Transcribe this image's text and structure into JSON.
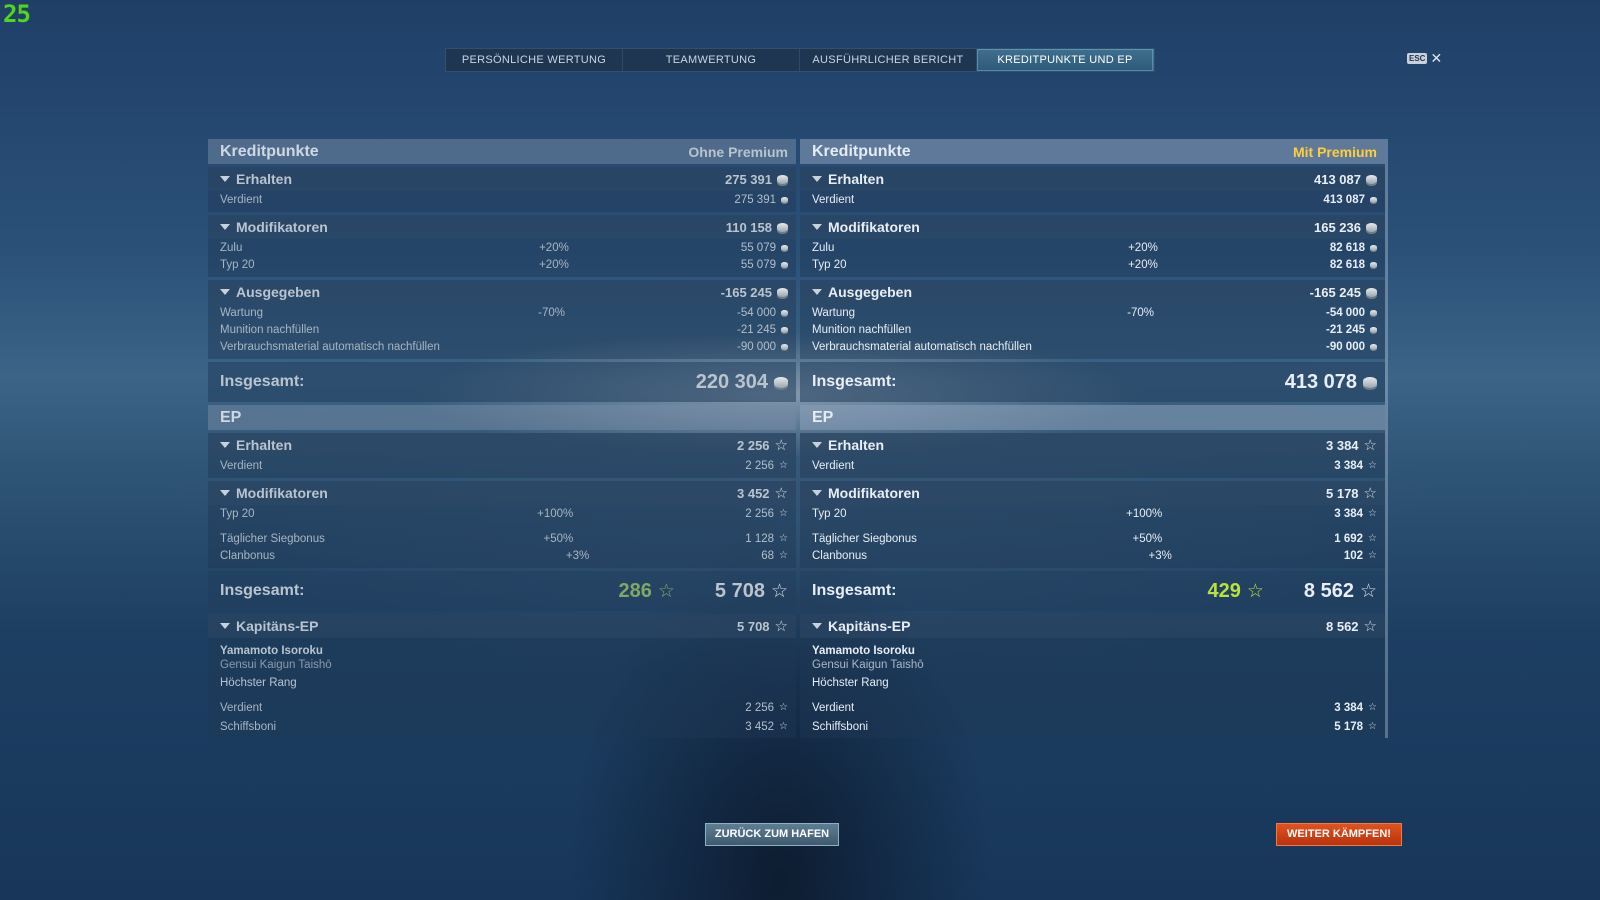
{
  "fps": "25",
  "tabs": [
    {
      "label": "PERSÖNLICHE WERTUNG",
      "active": false
    },
    {
      "label": "TEAMWERTUNG",
      "active": false
    },
    {
      "label": "AUSFÜHRLICHER BERICHT",
      "active": false
    },
    {
      "label": "KREDITPUNKTE UND EP",
      "active": true
    }
  ],
  "esc": {
    "key": "ESC",
    "close": "✕"
  },
  "buttons": {
    "back_to_port": "ZURÜCK ZUM HAFEN",
    "keep_fighting": "WEITER KÄMPFEN!"
  },
  "colors": {
    "premium_accent": "#ffcf3a",
    "xp_green": "#b9e23f",
    "fight_button": "#d9471a"
  },
  "left": {
    "credits_title": "Kreditpunkte",
    "premium_label": "Ohne Premium",
    "earned": {
      "label": "Erhalten",
      "value": "275 391",
      "rows": [
        {
          "label": "Verdient",
          "value": "275 391"
        }
      ]
    },
    "modifiers": {
      "label": "Modifikatoren",
      "value": "110 158",
      "rows": [
        {
          "label": "Zulu",
          "pct": "+20%",
          "value": "55 079"
        },
        {
          "label": "Typ 20",
          "pct": "+20%",
          "value": "55 079"
        }
      ]
    },
    "spent": {
      "label": "Ausgegeben",
      "value": "-165 245",
      "rows": [
        {
          "label": "Wartung",
          "pct": "-70%",
          "value": "-54 000"
        },
        {
          "label": "Munition nachfüllen",
          "pct": "",
          "value": "-21 245"
        },
        {
          "label": "Verbrauchsmaterial automatisch nachfüllen",
          "pct": "",
          "value": "-90 000"
        }
      ]
    },
    "credits_total": {
      "label": "Insgesamt:",
      "value": "220 304"
    },
    "xp_title": "EP",
    "xp_earned": {
      "label": "Erhalten",
      "value": "2 256",
      "rows": [
        {
          "label": "Verdient",
          "value": "2 256"
        }
      ]
    },
    "xp_modifiers": {
      "label": "Modifikatoren",
      "value": "3 452",
      "rows": [
        {
          "label": "Typ 20",
          "pct": "+100%",
          "value": "2 256"
        },
        {
          "label": "Täglicher Siegbonus",
          "pct": "+50%",
          "value": "1 128"
        },
        {
          "label": "Clanbonus",
          "pct": "+3%",
          "value": "68"
        }
      ]
    },
    "xp_total": {
      "label": "Insgesamt:",
      "base": "286",
      "value": "5 708"
    },
    "captain": {
      "label": "Kapitäns-EP",
      "value": "5 708",
      "name": "Yamamoto Isoroku",
      "rank": "Gensui Kaigun Taishō",
      "status": "Höchster Rang",
      "rows": [
        {
          "label": "Verdient",
          "value": "2 256"
        },
        {
          "label": "Schiffsboni",
          "value": "3 452"
        }
      ]
    }
  },
  "right": {
    "credits_title": "Kreditpunkte",
    "premium_label": "Mit Premium",
    "earned": {
      "label": "Erhalten",
      "value": "413 087",
      "rows": [
        {
          "label": "Verdient",
          "value": "413 087"
        }
      ]
    },
    "modifiers": {
      "label": "Modifikatoren",
      "value": "165 236",
      "rows": [
        {
          "label": "Zulu",
          "pct": "+20%",
          "value": "82 618"
        },
        {
          "label": "Typ 20",
          "pct": "+20%",
          "value": "82 618"
        }
      ]
    },
    "spent": {
      "label": "Ausgegeben",
      "value": "-165 245",
      "rows": [
        {
          "label": "Wartung",
          "pct": "-70%",
          "value": "-54 000"
        },
        {
          "label": "Munition nachfüllen",
          "pct": "",
          "value": "-21 245"
        },
        {
          "label": "Verbrauchsmaterial automatisch nachfüllen",
          "pct": "",
          "value": "-90 000"
        }
      ]
    },
    "credits_total": {
      "label": "Insgesamt:",
      "value": "413 078"
    },
    "xp_title": "EP",
    "xp_earned": {
      "label": "Erhalten",
      "value": "3 384",
      "rows": [
        {
          "label": "Verdient",
          "value": "3 384"
        }
      ]
    },
    "xp_modifiers": {
      "label": "Modifikatoren",
      "value": "5 178",
      "rows": [
        {
          "label": "Typ 20",
          "pct": "+100%",
          "value": "3 384"
        },
        {
          "label": "Täglicher Siegbonus",
          "pct": "+50%",
          "value": "1 692"
        },
        {
          "label": "Clanbonus",
          "pct": "+3%",
          "value": "102"
        }
      ]
    },
    "xp_total": {
      "label": "Insgesamt:",
      "base": "429",
      "value": "8 562"
    },
    "captain": {
      "label": "Kapitäns-EP",
      "value": "8 562",
      "name": "Yamamoto Isoroku",
      "rank": "Gensui Kaigun Taishō",
      "status": "Höchster Rang",
      "rows": [
        {
          "label": "Verdient",
          "value": "3 384"
        },
        {
          "label": "Schiffsboni",
          "value": "5 178"
        }
      ]
    }
  }
}
